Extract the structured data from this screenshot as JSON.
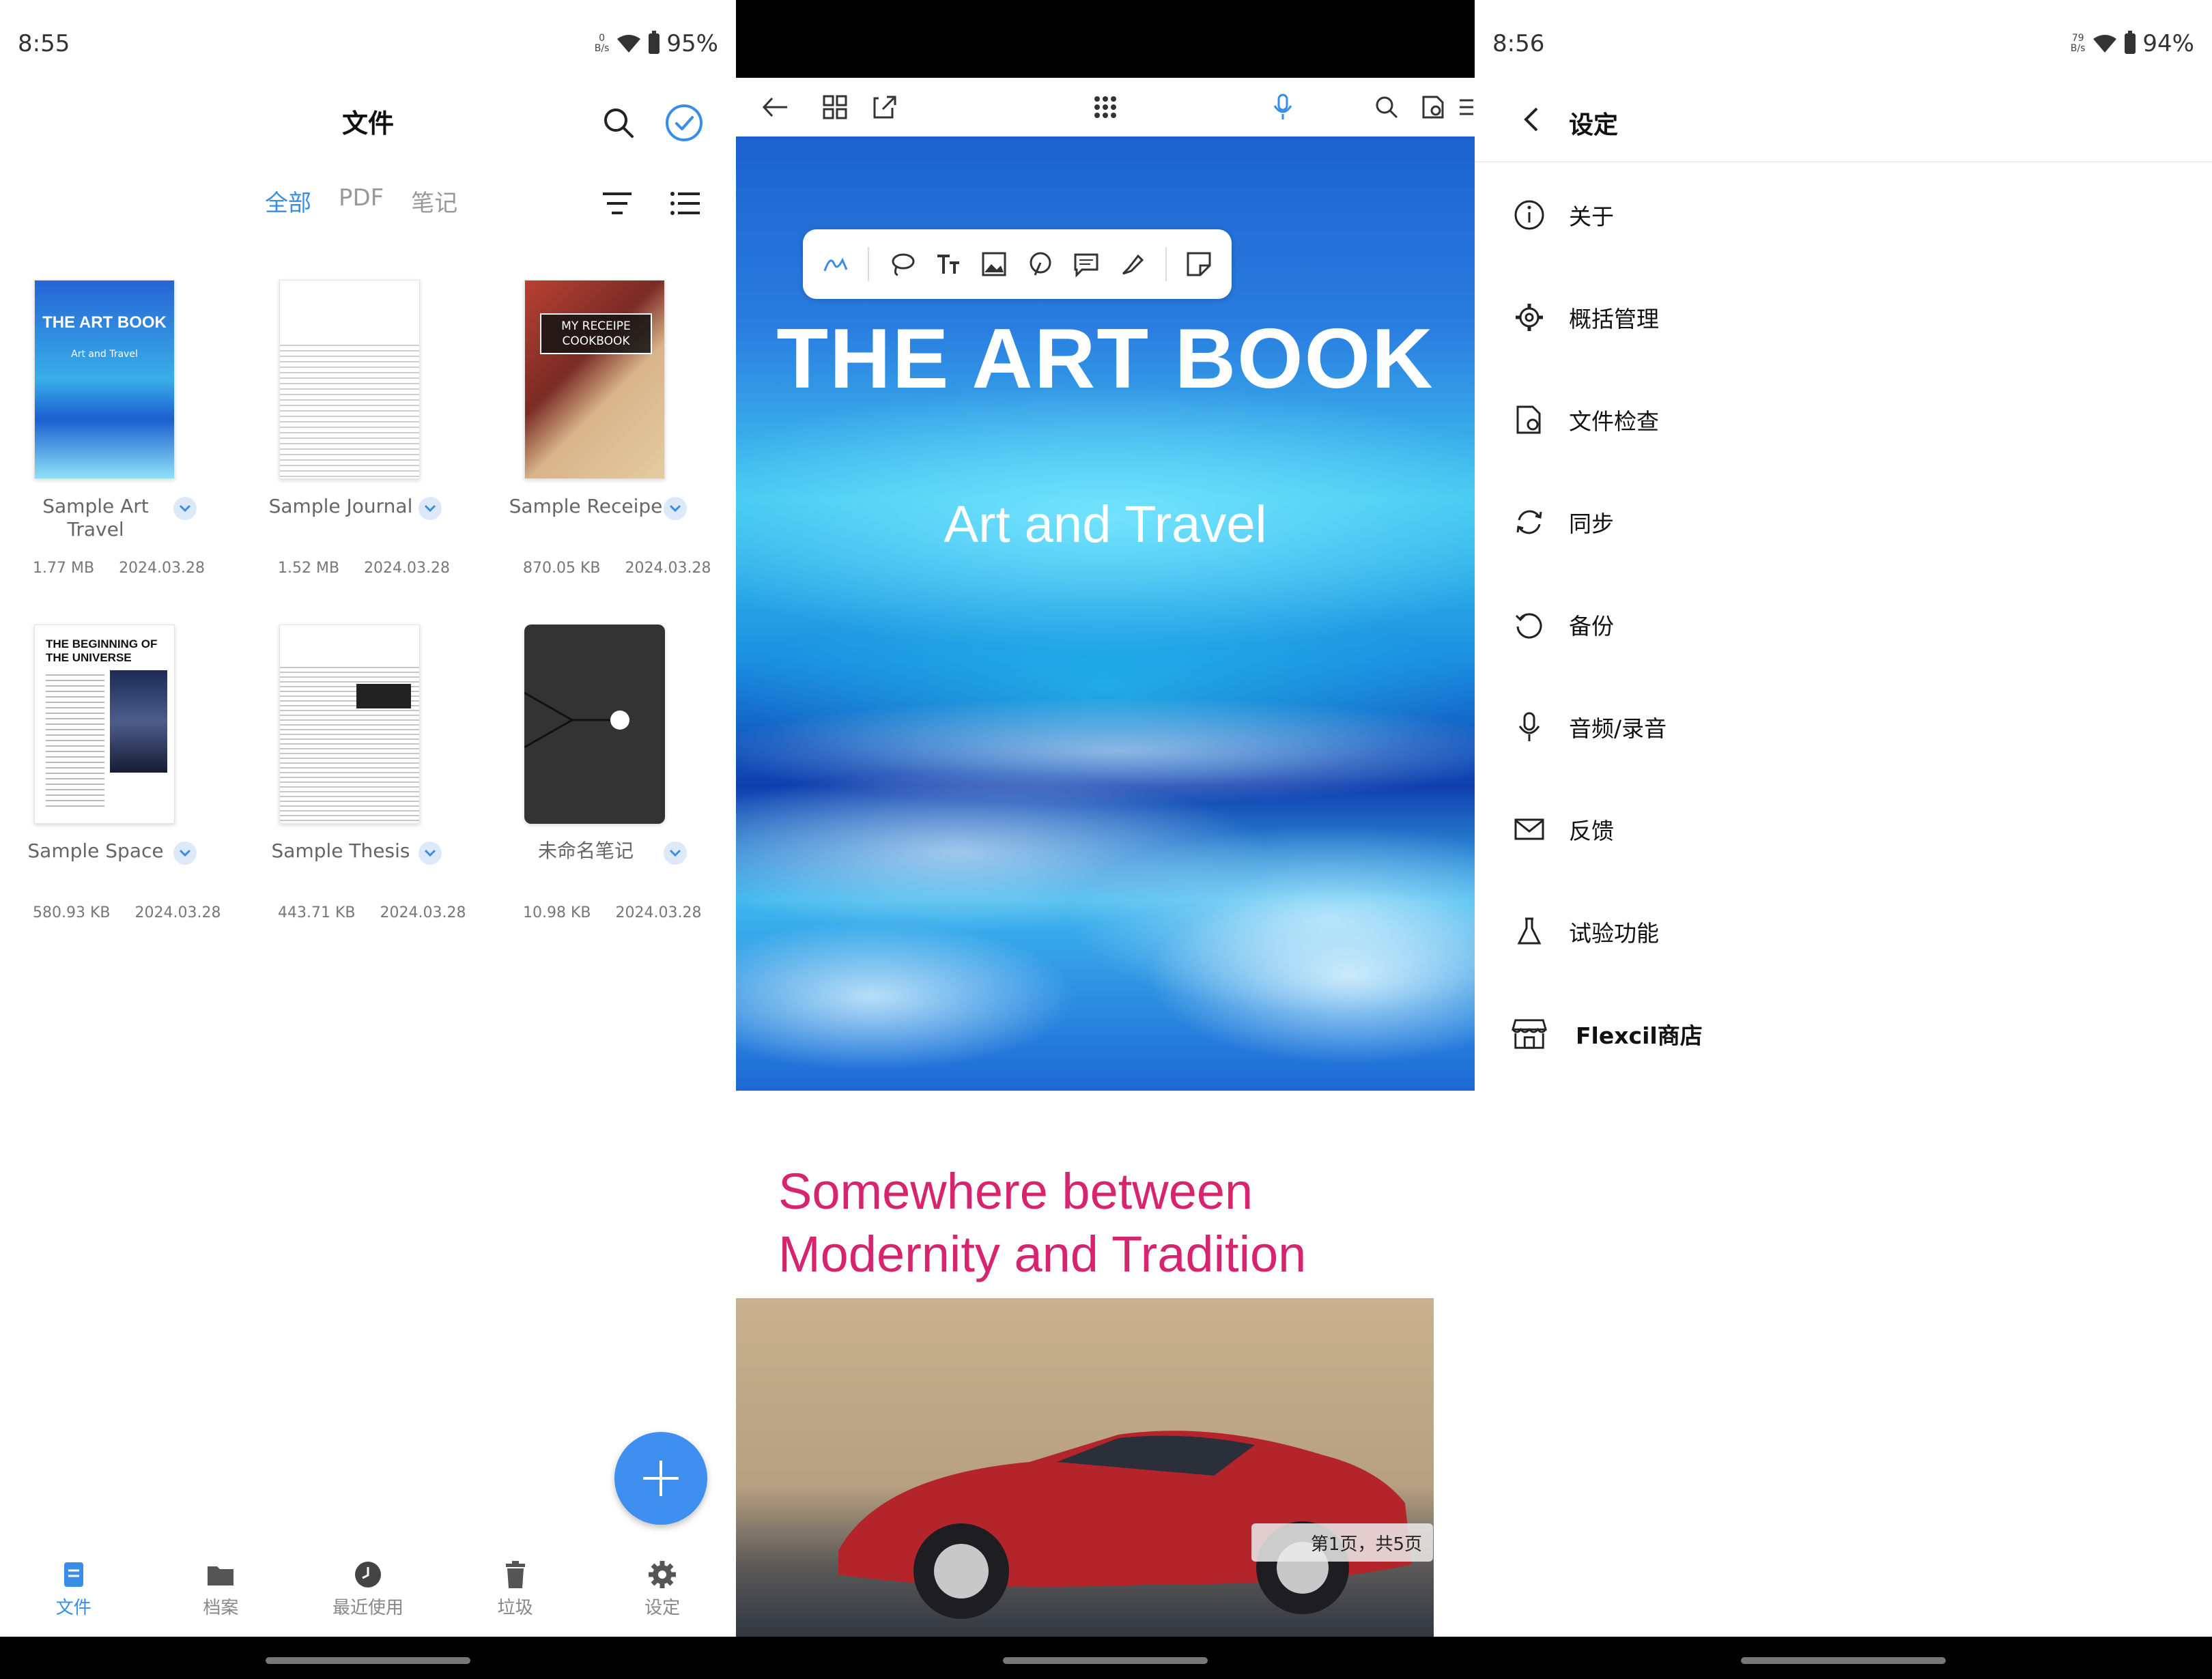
{
  "panel1": {
    "status": {
      "time": "8:55",
      "netspeed_value": "0",
      "netspeed_unit": "B/s",
      "battery": "95%"
    },
    "title": "文件",
    "tabs": [
      {
        "label": "全部"
      },
      {
        "label": "PDF"
      },
      {
        "label": "笔记"
      }
    ],
    "files": [
      {
        "name": "Sample Art Travel",
        "size": "1.77 MB",
        "date": "2024.03.28",
        "thumb_title": "THE ART BOOK",
        "thumb_sub": "Art and Travel"
      },
      {
        "name": "Sample Journal",
        "size": "1.52 MB",
        "date": "2024.03.28"
      },
      {
        "name": "Sample Receipe",
        "size": "870.05 KB",
        "date": "2024.03.28",
        "thumb_title": "MY RECEIPE COOKBOOK"
      },
      {
        "name": "Sample Space",
        "size": "580.93 KB",
        "date": "2024.03.28",
        "thumb_title": "THE BEGINNING OF THE UNIVERSE"
      },
      {
        "name": "Sample Thesis",
        "size": "443.71 KB",
        "date": "2024.03.28"
      },
      {
        "name": "未命名笔记",
        "size": "10.98 KB",
        "date": "2024.03.28"
      }
    ],
    "nav": [
      {
        "label": "文件"
      },
      {
        "label": "档案"
      },
      {
        "label": "最近使用"
      },
      {
        "label": "垃圾"
      },
      {
        "label": "设定"
      }
    ],
    "accent": "#3a8de6"
  },
  "panel2": {
    "cover_title": "THE ART BOOK",
    "cover_subtitle": "Art and Travel",
    "heading_line1": "Somewhere between",
    "heading_line2": "Modernity and Tradition",
    "page_indicator": "第1页，共5页",
    "heading_color": "#d6246e"
  },
  "panel3": {
    "status": {
      "time": "8:56",
      "netspeed_value": "79",
      "netspeed_unit": "B/s",
      "battery": "94%"
    },
    "title": "设定",
    "menu": [
      {
        "label": "关于",
        "icon": "info-icon"
      },
      {
        "label": "概括管理",
        "icon": "gear-icon"
      },
      {
        "label": "文件检查",
        "icon": "file-check-icon"
      },
      {
        "label": "同步",
        "icon": "sync-icon"
      },
      {
        "label": "备份",
        "icon": "backup-icon"
      },
      {
        "label": "音频/录音",
        "icon": "microphone-icon"
      },
      {
        "label": "反馈",
        "icon": "mail-icon"
      },
      {
        "label": "试验功能",
        "icon": "flask-icon"
      },
      {
        "label": "Flexcil商店",
        "icon": "store-icon"
      }
    ]
  }
}
